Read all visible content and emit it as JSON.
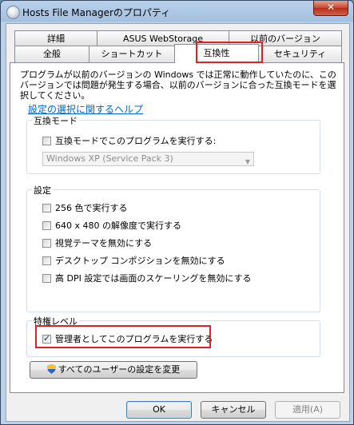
{
  "window": {
    "title": "Hosts File Managerのプロパティ",
    "close_label": "✕"
  },
  "tabs_back": [
    {
      "label": "詳細"
    },
    {
      "label": "ASUS WebStorage"
    },
    {
      "label": "以前のバージョン"
    }
  ],
  "tabs_front": [
    {
      "label": "全般"
    },
    {
      "label": "ショートカット"
    },
    {
      "label": "互換性"
    },
    {
      "label": "セキュリティ"
    }
  ],
  "description": "プログラムが以前のバージョンの Windows では正常に動作していたのに、このバージョンでは問題が発生する場合、以前のバージョンに合った互換モードを選択してください。",
  "help_link": "設定の選択に関するヘルプ",
  "compat_mode": {
    "group_label": "互換モード",
    "checkbox_label": "互換モードでこのプログラムを実行する:",
    "checked": false,
    "select_value": "Windows XP (Service Pack 3)"
  },
  "settings": {
    "group_label": "設定",
    "options": [
      {
        "label": "256 色で実行する",
        "checked": false
      },
      {
        "label": "640 x 480 の解像度で実行する",
        "checked": false
      },
      {
        "label": "視覚テーマを無効にする",
        "checked": false
      },
      {
        "label": "デスクトップ コンポジションを無効にする",
        "checked": false
      },
      {
        "label": "高 DPI 設定では画面のスケーリングを無効にする",
        "checked": false
      }
    ]
  },
  "privilege": {
    "group_label": "特権レベル",
    "checkbox_label": "管理者としてこのプログラムを実行する",
    "checked": true
  },
  "all_users_button": "すべてのユーザーの設定を変更",
  "footer": {
    "ok": "OK",
    "cancel": "キャンセル",
    "apply": "適用(A)"
  },
  "colors": {
    "highlight_box": "#e0202a",
    "link": "#0066cc"
  }
}
